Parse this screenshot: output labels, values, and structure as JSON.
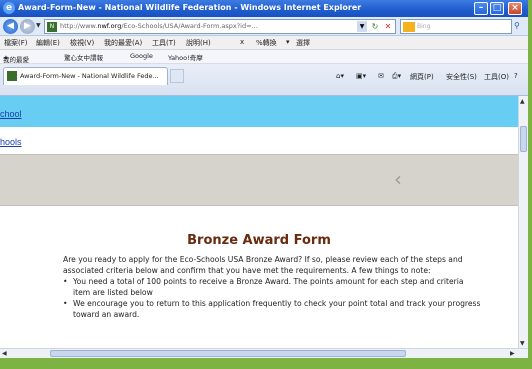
{
  "window": {
    "title": "Award-Form-New - National Wildlife Federation - Windows Internet Explorer"
  },
  "address": {
    "url_prefix": "http://www.",
    "url_domain": "nwf.org",
    "url_rest": "/Eco-Schools/USA/Award-Form.aspx?id=...",
    "search_placeholder": "Bing"
  },
  "menu": {
    "items": [
      "檔案(F)",
      "編輯(E)",
      "檢視(V)",
      "我的最愛(A)",
      "工具(T)",
      "說明(H)"
    ],
    "extra": [
      "x",
      "%轉換",
      "▾",
      "選擇"
    ]
  },
  "favorites": {
    "label": "我的最愛",
    "items": [
      "驚心女中謂報",
      "Google",
      "Yahoo!奇摩"
    ]
  },
  "tabs": [
    {
      "label": "Award-Form-New - National Wildlife Fede..."
    }
  ],
  "command_bar": {
    "page": "網頁(P)",
    "safety": "安全性(S)",
    "tools": "工具(O)"
  },
  "page": {
    "link_school": "chool",
    "link_schools": "hools",
    "form_title": "Bronze Award Form",
    "intro": "Are you ready to apply for the Eco-Schools USA Bronze Award? If so, please review each of the steps and associated criteria below and confirm that you have met the requirements. A few things to note:",
    "bullets": [
      "You need a total of 100 points to receive a Bronze Award. The points amount for each step and criteria item are listed below",
      "We encourage you to return to this application frequently to check your point total and track your progress toward an award."
    ]
  }
}
